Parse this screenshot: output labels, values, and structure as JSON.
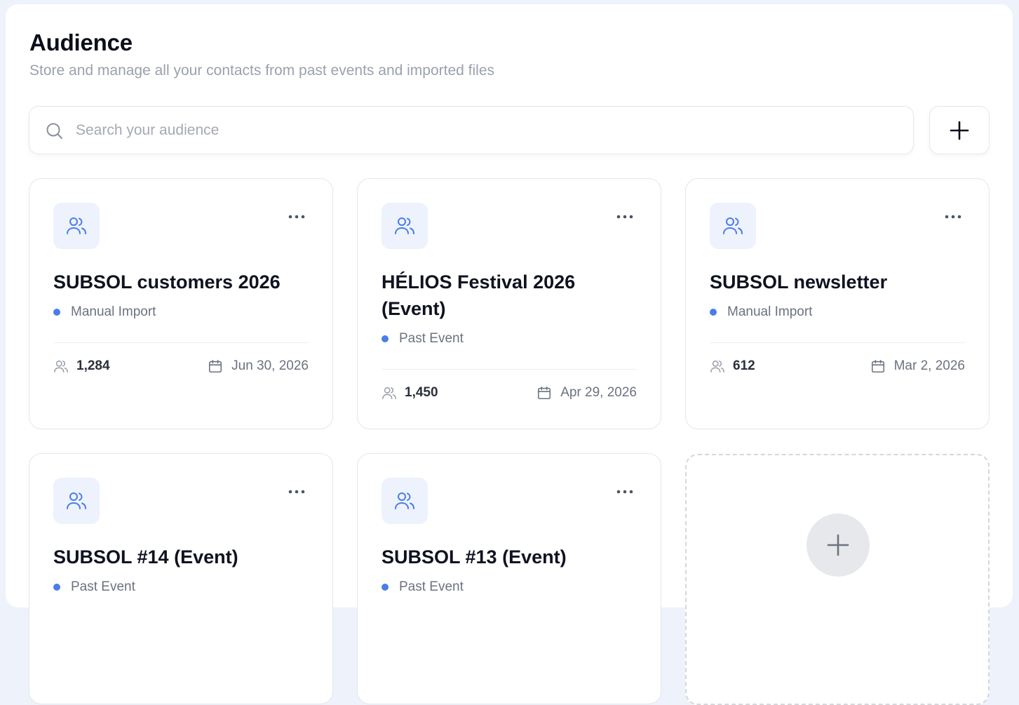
{
  "header": {
    "title": "Audience",
    "subtitle": "Store and manage all your contacts from past events and imported files"
  },
  "search": {
    "placeholder": "Search your audience",
    "value": ""
  },
  "icons": {
    "search": "search-icon",
    "add": "plus-icon",
    "audience": "users-icon",
    "more": "more-horizontal-icon",
    "contacts": "users-icon",
    "date": "calendar-icon"
  },
  "colors": {
    "accent": "#4a7de8",
    "icon_bg": "#edf2fd",
    "subtitle": "#9aa1ad",
    "border": "#e3e6ec"
  },
  "cards": [
    {
      "title": "SUBSOL customers 2026",
      "source": "Manual Import",
      "count": "1,284",
      "date": "Jun 30, 2026"
    },
    {
      "title": "HÉLIOS Festival 2026 (Event)",
      "source": "Past Event",
      "count": "1,450",
      "date": "Apr 29, 2026"
    },
    {
      "title": "SUBSOL newsletter",
      "source": "Manual Import",
      "count": "612",
      "date": "Mar 2, 2026"
    },
    {
      "title": "SUBSOL #14 (Event)",
      "source": "Past Event"
    },
    {
      "title": "SUBSOL #13 (Event)",
      "source": "Past Event"
    }
  ]
}
